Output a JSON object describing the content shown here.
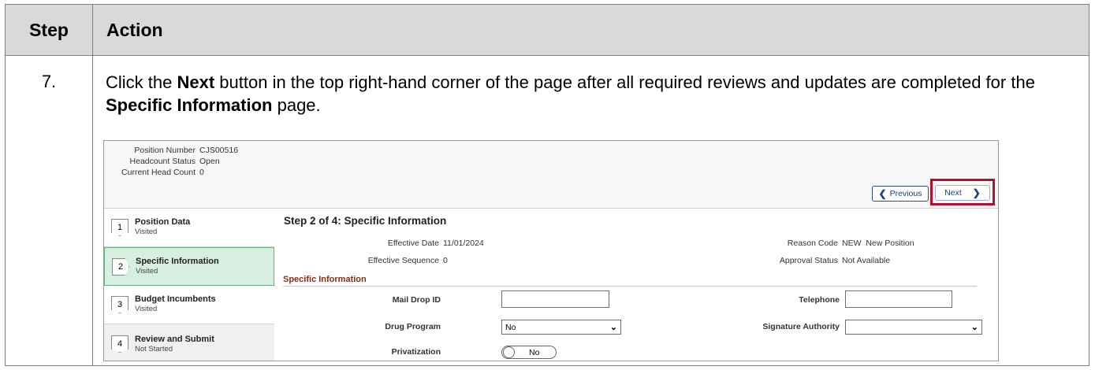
{
  "table": {
    "header_step": "Step",
    "header_action": "Action",
    "step_number": "7.",
    "instruction": {
      "part1": "Click the ",
      "bold1": "Next",
      "part2": " button in the top right-hand corner of the page after all required reviews and updates are completed for the ",
      "bold2": "Specific Information",
      "part3": " page."
    }
  },
  "screenshot": {
    "header_info": [
      {
        "label": "Position Number",
        "value": "CJS00516"
      },
      {
        "label": "Headcount Status",
        "value": "Open"
      },
      {
        "label": "Current Head Count",
        "value": "0"
      }
    ],
    "nav": {
      "previous_label": "Previous",
      "next_label": "Next",
      "prev_icon": "chevron-left-icon",
      "next_icon": "chevron-right-icon",
      "highlight_color": "#b0112e"
    },
    "steps": [
      {
        "number": "1",
        "title": "Position Data",
        "status": "Visited"
      },
      {
        "number": "2",
        "title": "Specific Information",
        "status": "Visited"
      },
      {
        "number": "3",
        "title": "Budget Incumbents",
        "status": "Visited"
      },
      {
        "number": "4",
        "title": "Review and Submit",
        "status": "Not Started"
      }
    ],
    "main": {
      "title": "Step 2 of 4: Specific Information",
      "effective_date_label": "Effective Date",
      "effective_date": "11/01/2024",
      "reason_code_label": "Reason Code",
      "reason_code": "NEW  New Position",
      "effective_sequence_label": "Effective Sequence",
      "effective_sequence": "0",
      "approval_status_label": "Approval Status",
      "approval_status": "Not Available",
      "section_title": "Specific Information",
      "mail_drop_label": "Mail Drop ID",
      "mail_drop_value": "",
      "telephone_label": "Telephone",
      "telephone_value": "",
      "drug_program_label": "Drug Program",
      "drug_program_value": "No",
      "signature_authority_label": "Signature Authority",
      "signature_authority_value": "",
      "privatization_label": "Privatization",
      "privatization_value": "No"
    }
  }
}
